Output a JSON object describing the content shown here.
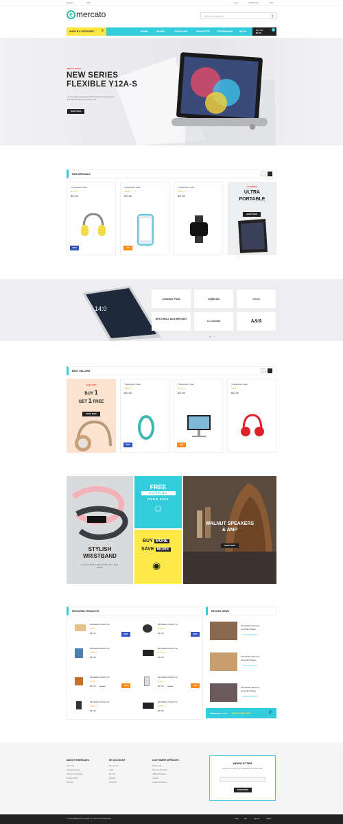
{
  "topbar": {
    "language": "English",
    "currency": "USD",
    "login": "Login",
    "wishlist": "Wishlist (0)",
    "currency2": "USD"
  },
  "logo": {
    "mark": "e",
    "text": "mercato"
  },
  "search": {
    "placeholder": "Enter your keywords..."
  },
  "nav": {
    "category_button": "SHOP BY CATEGORY",
    "items": [
      "HOME",
      "PAGES",
      "CATEGORY",
      "PRODUCTS",
      "TOP BRANDS",
      "BLOG"
    ],
    "cart_label": "My Cart",
    "cart_value": "$0.00",
    "cart_count": "0"
  },
  "hero": {
    "tag": "BEST CHOICE",
    "title_line1": "NEW SERIES",
    "title_line2": "FLEXIBLE Y12A-S",
    "desc": "Yoc can easily expand your 32 GB of internal memory to up to 200 GB with a Micro SD memory card.",
    "button": "SHOP NOW"
  },
  "new_arrivals": {
    "title": "NEW ARRIVALS",
    "products": [
      {
        "name": "Transparent Case",
        "stars": "★★★☆☆",
        "price": "$17.00",
        "badge": "NEW"
      },
      {
        "name": "Transparent Case",
        "stars": "★★★☆☆",
        "price": "$17.00",
        "badge": "-35%"
      },
      {
        "name": "Transparent Case",
        "stars": "★★★☆☆",
        "price": "$17.00",
        "badge": ""
      }
    ],
    "promo": {
      "tag": "Y4 SERIES",
      "line1": "ULTRA",
      "line2": "PORTABLE",
      "button": "SHOP NOW"
    }
  },
  "brands": {
    "items": [
      "Creative Flow",
      "California",
      "infinity",
      "MITCHELL and BRYANT",
      "ALL AROUND",
      "A&R"
    ],
    "phone_time": "14:0"
  },
  "best_sellers": {
    "title": "BEST SELLERS",
    "promo": {
      "tag": "SALE OFF",
      "line1": "BUY",
      "n1": "1",
      "line2": "GET",
      "n2": "1",
      "line3": "FREE",
      "button": "SHOP NOW"
    },
    "products": [
      {
        "name": "Transparent Case",
        "stars": "★★★☆☆",
        "price": "$17.00",
        "badge": "NEW"
      },
      {
        "name": "Transparent Case",
        "stars": "★★★☆☆",
        "price": "$17.00",
        "badge": "-35%"
      },
      {
        "name": "Transparent Case",
        "stars": "★★★☆☆",
        "price": "$17.00",
        "badge": ""
      }
    ]
  },
  "promos": {
    "wristband_title1": "STYLISH",
    "wristband_title2": "WRISTBAND",
    "wristband_desc": "Everyone wears because it makes you a better person!",
    "free": "FREE",
    "shipping": "SHIPPING",
    "over": "OVER $300",
    "buy": "BUY",
    "save": "SAVE",
    "more1": "MORE",
    "more2": "MORE",
    "walnut1": "WALNUT SPEAKERS",
    "walnut2": "& AMP",
    "walnut_button": "SHOP NOW"
  },
  "featured": {
    "title": "FEATURED PRODUCTS",
    "items": [
      {
        "name": "HP Pavilion 27wd 27-in",
        "stars": "★★★☆☆",
        "price": "$17.00",
        "old": "",
        "badge": "NEW"
      },
      {
        "name": "HP Pavilion 27wd 27-in",
        "stars": "★★★☆☆",
        "price": "$17.00",
        "old": "",
        "badge": "NEW"
      },
      {
        "name": "HP Pavilion 27wd 27-in",
        "stars": "★★★☆☆",
        "price": "$17.00",
        "old": "",
        "badge": ""
      },
      {
        "name": "HP Pavilion 27wd 27-in",
        "stars": "★★★☆☆",
        "price": "$17.00",
        "old": "",
        "badge": ""
      },
      {
        "name": "HP Pavilion 27wd 27-in",
        "stars": "★★★☆☆",
        "price": "$17.00",
        "old": "$49.00",
        "badge": "-10%"
      },
      {
        "name": "HP Pavilion 27wd 27-in",
        "stars": "★★★☆☆",
        "price": "$17.00",
        "old": "$49.00",
        "badge": "-10%"
      },
      {
        "name": "HP Pavilion 27wd 27-in",
        "stars": "★★★☆☆",
        "price": "$17.00",
        "old": "",
        "badge": ""
      },
      {
        "name": "HP Pavilion 27wd 27-in",
        "stars": "★★★☆☆",
        "price": "$17.00",
        "old": "",
        "badge": ""
      }
    ]
  },
  "news": {
    "title": "RECENT NEWS",
    "items": [
      {
        "title1": "The World's Telecoms",
        "title2": "Are Under Threat",
        "date": "12.06.02/01/2016"
      },
      {
        "title1": "The World's Telecoms",
        "title2": "Are Under Threat",
        "date": "12.06.02/01/2016"
      },
      {
        "title1": "The World's Telecoms",
        "title2": "Are Under Threat",
        "date": "12.06.02/01/2016"
      }
    ],
    "help_label": "NEED HELP? CALL",
    "help_phone": "0123 2456 789"
  },
  "footer": {
    "col1_title": "ABOUT EMERCATO",
    "col1": [
      "About Us",
      "Shopping Guide",
      "Delivery Information",
      "Privacy Policy",
      "Sitemap"
    ],
    "col2_title": "MY ACCOUNT",
    "col2": [
      "My account",
      "Login",
      "My cart",
      "Wishlist",
      "Checkout"
    ],
    "col3_title": "CUSTOMER SERVICES",
    "col3": [
      "Return cart",
      "Sell Your Products",
      "Affiliate Program",
      "Careers",
      "Investor Relations"
    ],
    "newsletter_title": "NEWSLETTER",
    "newsletter_desc": "Enter your email to get newsletter from Emercato",
    "subscribe": "SUBSCRIBE",
    "copyright": "© 2016 EMERCATO STORE. ALL RIGHTS RESERVED.",
    "payments": [
      "VISA",
      "MC",
      "PayPal",
      "AMEX"
    ]
  },
  "colors": {
    "accent": "#33ccdd",
    "yellow": "#ffe640",
    "dark": "#222222",
    "orange": "#ff8a1a",
    "blue": "#3355bb"
  }
}
